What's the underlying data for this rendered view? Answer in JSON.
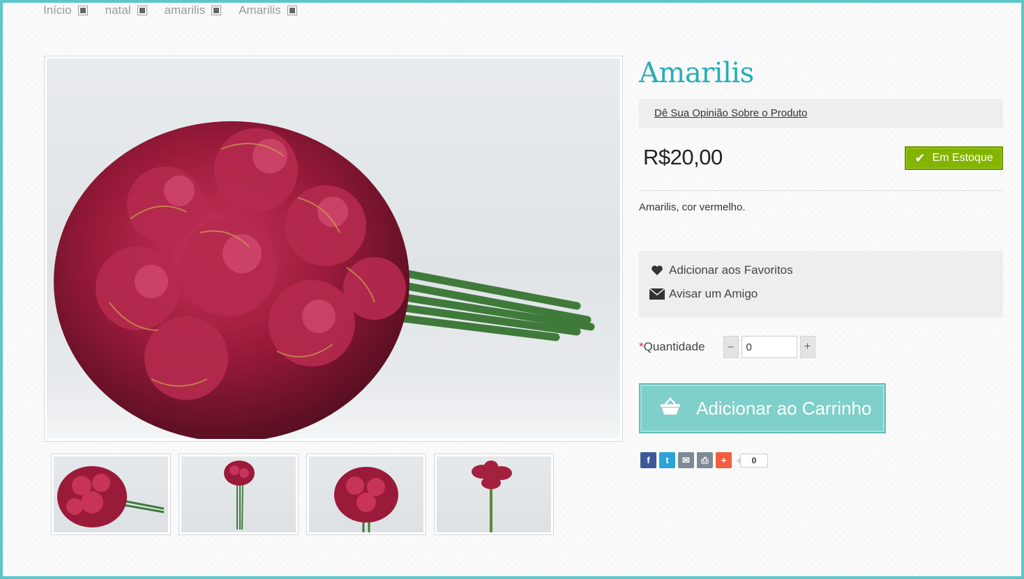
{
  "breadcrumb": [
    "Início",
    "natal",
    "amarilis",
    "Amarilis"
  ],
  "product": {
    "title": "Amarilis",
    "review_link": "Dê Sua Opinião Sobre o Produto",
    "price": "R$20,00",
    "stock_label": "Em Estoque",
    "description": "Amarilis, cor vermelho."
  },
  "actions": {
    "favorites": "Adicionar aos Favoritos",
    "tell_friend": "Avisar um Amigo"
  },
  "quantity": {
    "label": "Quantidade",
    "required_mark": "*",
    "value": "0",
    "minus": "–",
    "plus": "+"
  },
  "cart_button": "Adicionar ao Carrinho",
  "share": {
    "icons": [
      "facebook-icon",
      "twitter-icon",
      "email-icon",
      "print-icon",
      "addthis-icon"
    ],
    "count": "0"
  },
  "colors": {
    "accent": "#27aeb4",
    "stock_green": "#83b400",
    "cart_button": "#7fcfca",
    "frame": "#5cc7c9"
  }
}
